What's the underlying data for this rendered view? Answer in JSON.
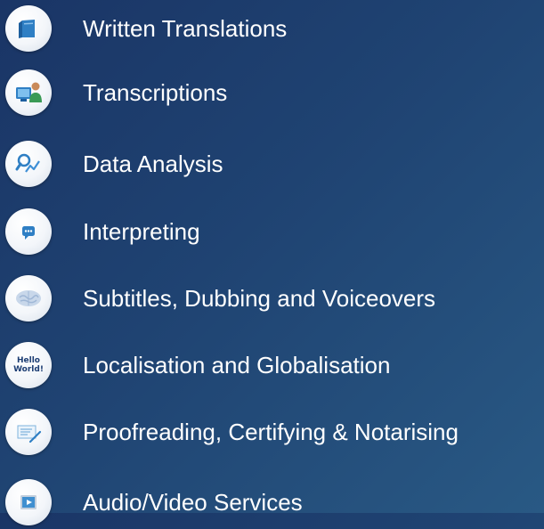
{
  "services": [
    {
      "label": "Written Translations",
      "icon": "document-icon"
    },
    {
      "label": "Transcriptions",
      "icon": "person-computer-icon"
    },
    {
      "label": "Data Analysis",
      "icon": "magnifier-chart-icon"
    },
    {
      "label": "Interpreting",
      "icon": "chat-bubble-icon"
    },
    {
      "label": "Subtitles, Dubbing and Voiceovers",
      "icon": "brain-icon"
    },
    {
      "label": "Localisation and Globalisation",
      "icon": "hello-world-icon",
      "icon_text": "Hello World!"
    },
    {
      "label": "Proofreading, Certifying & Notarising",
      "icon": "certificate-pen-icon"
    },
    {
      "label": "Audio/Video Services",
      "icon": "video-screen-icon"
    }
  ],
  "colors": {
    "background_start": "#1a3566",
    "background_end": "#295984",
    "icon_blue": "#2f7fc4",
    "text": "#ffffff"
  }
}
